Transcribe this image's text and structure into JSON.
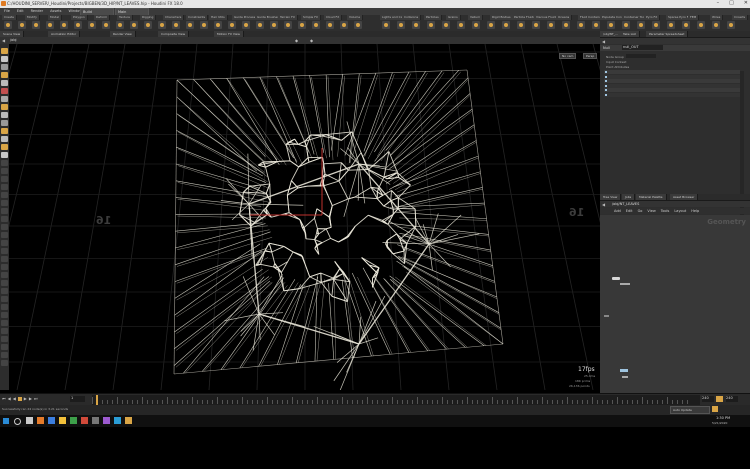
{
  "window": {
    "title": "C:/HOUDINI_SERVER/_Houdini/Projects/BIGBEN/3D_HIP/NT_LEAVES.hip - Houdini FX 18.0"
  },
  "menubar": {
    "items": [
      "File",
      "Edit",
      "Render",
      "Assets",
      "Windows",
      "Help"
    ],
    "desktop": "Build",
    "shelf_set": "Main"
  },
  "shelf": {
    "tabs": [
      "Create",
      "Modify",
      "Model",
      "Polygon",
      "Deform",
      "Texture",
      "Rigging",
      "Characters",
      "Constraints",
      "Hair Utils",
      "Guide Process",
      "Guide Brushes",
      "Terrain FX",
      "Simple FX",
      "Cloud FX",
      "Volume"
    ],
    "tabs_right": [
      "Lights and Cameras",
      "Collisions",
      "Particles",
      "Grains",
      "Vellum",
      "Rigid Bodies",
      "Particle Fluids",
      "Viscous Fluids",
      "Oceans",
      "Fluid Containers",
      "Populate Containers",
      "Container Tools",
      "Pyro FX",
      "Sparse Pyro FX",
      "FEM",
      "Wires",
      "Crowds",
      "Drive Simulation"
    ]
  },
  "pane_tabs": {
    "items": [
      "Scene View",
      "Animation Editor",
      "Render View",
      "Composite View",
      "Motion FX View"
    ],
    "path": "/obj"
  },
  "viewport": {
    "camera_menu": "No cam",
    "persp_menu": "Persp",
    "grid_label_left": "16",
    "grid_label_right": "16",
    "fps": "17fps",
    "stats_line1": "25.4ms",
    "stats_line2": "18K  prims",
    "stats_line3": "26,136 points"
  },
  "right_top": {
    "tabs": [
      "/obj/NT_...",
      "Take List",
      "Parameter Spreadsheet"
    ],
    "node_type": "Null",
    "node_name": "null_OUT",
    "params": [
      "Node Group",
      "Input Context",
      "Point Attributes"
    ]
  },
  "network": {
    "tabs": [
      "Tree View",
      "Jobs",
      "Material Palette",
      "Asset Browser"
    ],
    "path": "/obj/NT_LEAVES",
    "menu": [
      "Add",
      "Edit",
      "Go",
      "View",
      "Tools",
      "Layout",
      "Help"
    ],
    "context_label": "Geometry"
  },
  "timeline": {
    "frame": "1",
    "start": "1",
    "end": "240",
    "end2": "240"
  },
  "statusbar": {
    "message": "Successfully ran 24 node(s) in 3.21 seconds",
    "auto_update": "Auto Update"
  },
  "taskbar": {
    "time": "1:30 PM",
    "date": "5/21/2020"
  },
  "colors": {
    "accent": "#d9a546",
    "viewport_bg": "#000000",
    "mesh_line": "#e9e6d8",
    "axis_x": "#c0322e",
    "axis_y": "#c0322e"
  }
}
